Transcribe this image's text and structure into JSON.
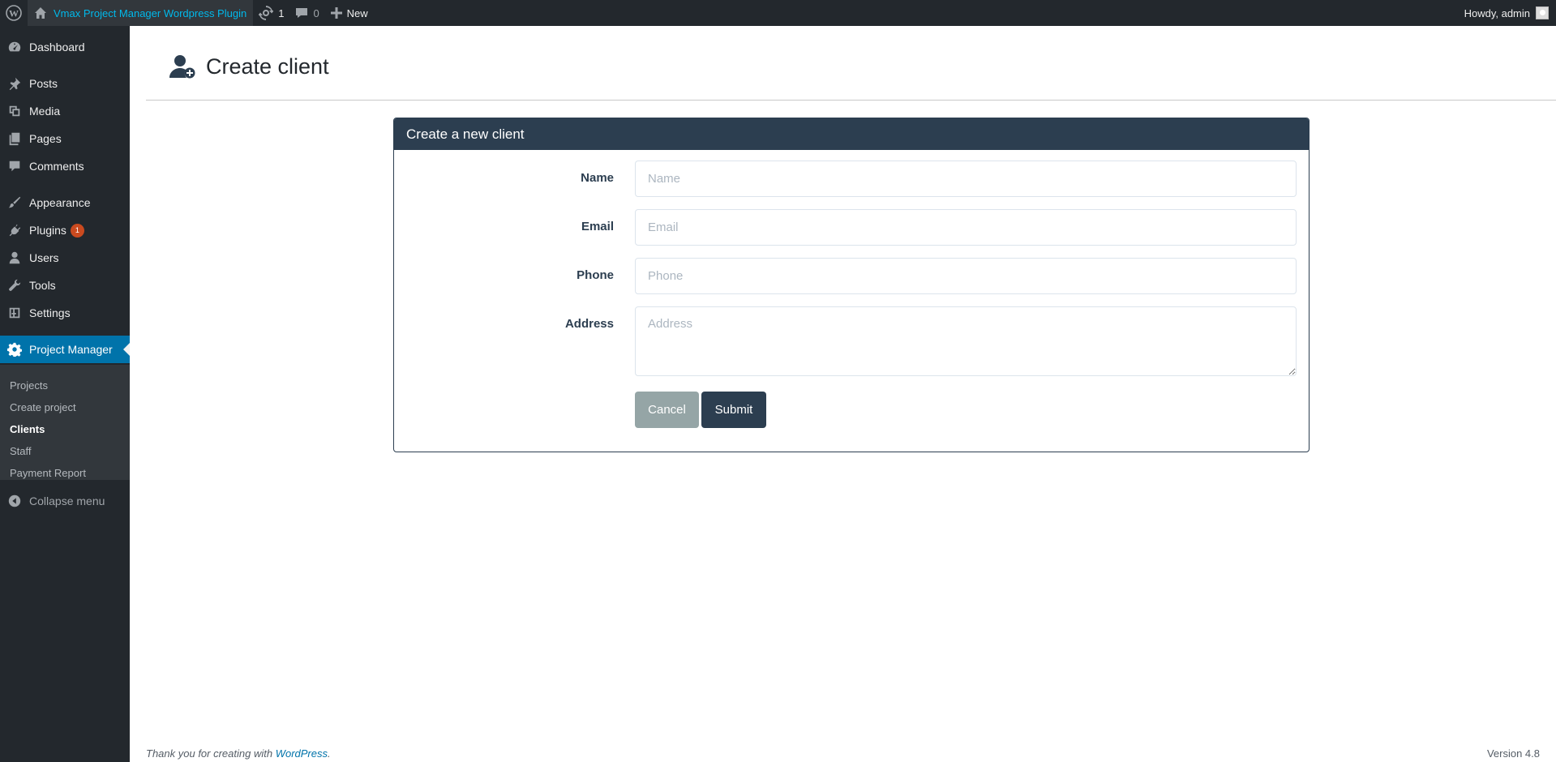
{
  "adminbar": {
    "site_name": "Vmax Project Manager Wordpress Plugin",
    "updates_count": "1",
    "comments_count": "0",
    "new_label": "New",
    "howdy": "Howdy, admin"
  },
  "sidebar": {
    "items": [
      {
        "label": "Dashboard",
        "icon": "dashboard-icon"
      },
      {
        "label": "Posts",
        "icon": "pin-icon"
      },
      {
        "label": "Media",
        "icon": "media-icon"
      },
      {
        "label": "Pages",
        "icon": "pages-icon"
      },
      {
        "label": "Comments",
        "icon": "comment-icon"
      },
      {
        "label": "Appearance",
        "icon": "brush-icon"
      },
      {
        "label": "Plugins",
        "icon": "plug-icon",
        "badge": "1"
      },
      {
        "label": "Users",
        "icon": "user-icon"
      },
      {
        "label": "Tools",
        "icon": "wrench-icon"
      },
      {
        "label": "Settings",
        "icon": "settings-icon"
      },
      {
        "label": "Project Manager",
        "icon": "gear-icon",
        "active": true
      }
    ],
    "submenu": [
      "Projects",
      "Create project",
      "Clients",
      "Staff",
      "Payment Report"
    ],
    "current_submenu": "Clients",
    "collapse_label": "Collapse menu"
  },
  "page": {
    "title": "Create client",
    "panel_heading": "Create a new client",
    "fields": [
      {
        "label": "Name",
        "placeholder": "Name",
        "value": ""
      },
      {
        "label": "Email",
        "placeholder": "Email",
        "value": ""
      },
      {
        "label": "Phone",
        "placeholder": "Phone",
        "value": ""
      },
      {
        "label": "Address",
        "placeholder": "Address",
        "value": ""
      }
    ],
    "cancel_label": "Cancel",
    "submit_label": "Submit"
  },
  "footer": {
    "thanks_prefix": "Thank you for creating with ",
    "thanks_link": "WordPress",
    "thanks_suffix": ".",
    "version": "Version 4.8"
  },
  "colors": {
    "adminbar_bg": "#23282d",
    "active_menu": "#0073aa",
    "panel_header": "#2c3e50",
    "cancel_button": "#95a5a6",
    "badge": "#ca4a1f"
  }
}
